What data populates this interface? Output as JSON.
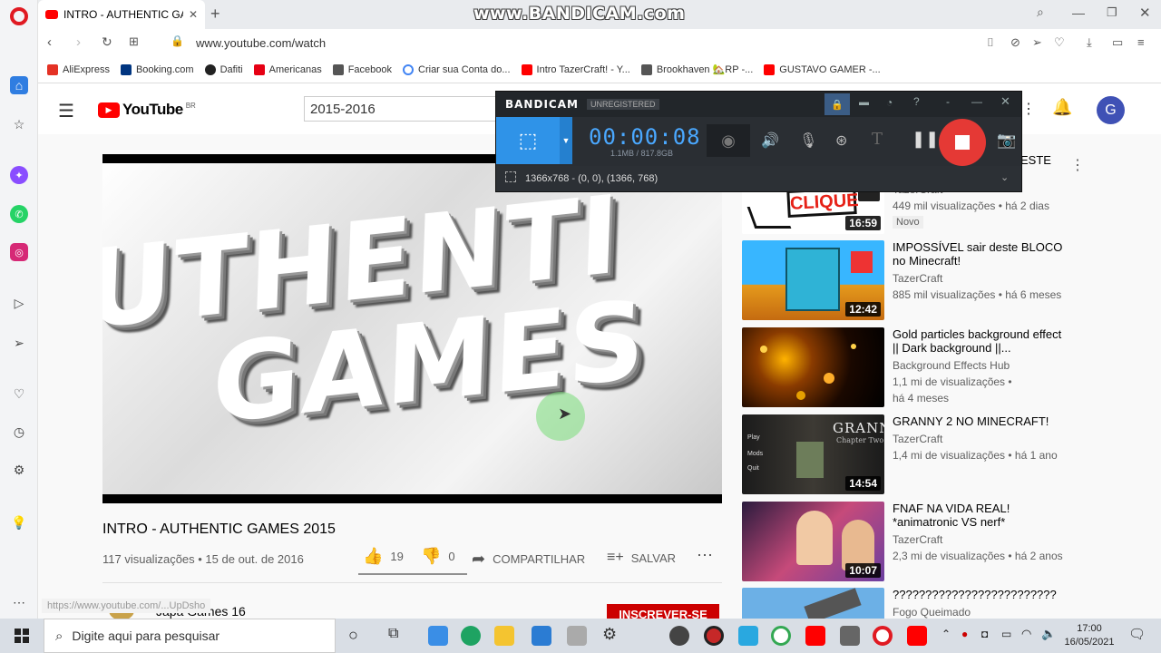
{
  "watermark": "www.BANDICAM.com",
  "browser": {
    "tab_title": "INTRO - AUTHENTIC GAMES",
    "url": "www.youtube.com/watch",
    "bookmarks": [
      "AliExpress",
      "Booking.com",
      "Dafiti",
      "Americanas",
      "Facebook",
      "Criar sua Conta do...",
      "Intro TazerCraft! - Y...",
      "Brookhaven 🏡RP -...",
      "GUSTAVO GAMER -..."
    ]
  },
  "youtube": {
    "logo_text": "YouTube",
    "region": "BR",
    "search_value": "2015-2016",
    "avatar_letter": "G",
    "video_title": "INTRO - AUTHENTIC GAMES 2015",
    "views_date": "117 visualizações • 15 de out. de 2016",
    "likes": "19",
    "dislikes": "0",
    "share_label": "COMPARTILHAR",
    "save_label": "SALVAR",
    "channel_name": "Japa Games 16",
    "subscribe_label": "INSCREVER-SE",
    "status_url": "https://www.youtube.com/...UpDsho",
    "partial_title": "ESTE",
    "recommendations": [
      {
        "title": "",
        "thumb_text": "CLIQUE",
        "channel": "TazerCraft",
        "meta": "449 mil visualizações • há 2 dias",
        "badge": "Novo",
        "duration": "16:59"
      },
      {
        "title": "IMPOSSÍVEL sair deste BLOCO no Minecraft!",
        "channel": "TazerCraft",
        "meta": "885 mil visualizações • há 6 meses",
        "duration": "12:42"
      },
      {
        "title": "Gold particles background effect || Dark background ||...",
        "channel": "Background Effects Hub",
        "meta": "1,1 mi de visualizações •",
        "meta2": "há 4 meses",
        "duration": ""
      },
      {
        "title": "GRANNY 2 NO MINECRAFT!",
        "thumb_text": "GRANNY",
        "thumb_sub": "Chapter Two",
        "menu": [
          "Play",
          "Mods",
          "Quit"
        ],
        "channel": "TazerCraft",
        "meta": "1,4 mi de visualizações • há 1 ano",
        "duration": "14:54"
      },
      {
        "title": "FNAF NA VIDA REAL! *animatronic VS nerf*",
        "channel": "TazerCraft",
        "meta": "2,3 mi de visualizações • há 2 anos",
        "duration": "10:07"
      },
      {
        "title": "?????????????????????????",
        "channel": "Fogo Queimado",
        "meta": "",
        "duration": ""
      }
    ]
  },
  "bandicam": {
    "logo": "BANDICAM",
    "unregistered": "UNREGISTERED",
    "timer": "00:00:08",
    "size_info": "1.1MB / 817.8GB",
    "region_info": "1366x768 - (0, 0), (1366, 768)"
  },
  "taskbar": {
    "search_placeholder": "Digite aqui para pesquisar",
    "time": "17:00",
    "date": "16/05/2021"
  },
  "colors": {
    "yt_red": "#ff0000",
    "bandicam_blue": "#2f93e8",
    "opera_red": "#e01a22"
  }
}
